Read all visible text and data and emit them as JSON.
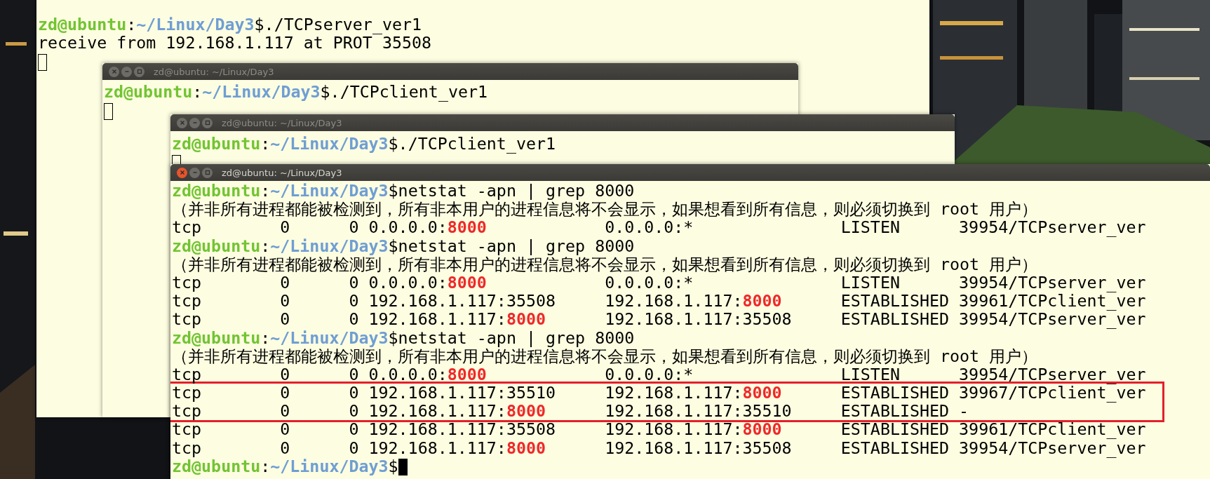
{
  "windows": [
    {
      "focused": false,
      "lines": [
        {
          "kind": "prompt",
          "user": "zd@ubuntu",
          "sep": ":",
          "path": "~/Linux/Day3",
          "sign": "$",
          "command": "./TCPserver_ver1"
        },
        {
          "kind": "output",
          "parts": [
            {
              "text": "receive from 192.168.1.117 at PROT 35508",
              "emphasis": false
            }
          ]
        },
        {
          "kind": "cursor"
        }
      ]
    },
    {
      "title": "zd@ubuntu: ~/Linux/Day3",
      "focused": false,
      "lines": [
        {
          "kind": "prompt",
          "user": "zd@ubuntu",
          "sep": ":",
          "path": "~/Linux/Day3",
          "sign": "$",
          "command": "./TCPclient_ver1"
        },
        {
          "kind": "cursor"
        }
      ]
    },
    {
      "title": "zd@ubuntu: ~/Linux/Day3",
      "focused": false,
      "lines": [
        {
          "kind": "prompt",
          "user": "zd@ubuntu",
          "sep": ":",
          "path": "~/Linux/Day3",
          "sign": "$",
          "command": "./TCPclient_ver1"
        },
        {
          "kind": "cursor"
        }
      ]
    },
    {
      "title": "zd@ubuntu: ~/Linux/Day3",
      "focused": true,
      "lines": [
        {
          "kind": "prompt",
          "user": "zd@ubuntu",
          "sep": ":",
          "path": "~/Linux/Day3",
          "sign": "$",
          "command": "netstat -apn | grep 8000"
        },
        {
          "kind": "output",
          "parts": [
            {
              "text": "（并非所有进程都能被检测到，所有非本用户的进程信息将不会显示，如果想看到所有信息，则必须切换到 root 用户）",
              "emphasis": false
            }
          ]
        },
        {
          "kind": "output",
          "parts": [
            {
              "text": "tcp        0      0 0.0.0.0:",
              "emphasis": false
            },
            {
              "text": "8000",
              "emphasis": true
            },
            {
              "text": "            0.0.0.0:*               LISTEN      39954/TCPserver_ver",
              "emphasis": false
            }
          ]
        },
        {
          "kind": "prompt",
          "user": "zd@ubuntu",
          "sep": ":",
          "path": "~/Linux/Day3",
          "sign": "$",
          "command": "netstat -apn | grep 8000"
        },
        {
          "kind": "output",
          "parts": [
            {
              "text": "（并非所有进程都能被检测到，所有非本用户的进程信息将不会显示，如果想看到所有信息，则必须切换到 root 用户）",
              "emphasis": false
            }
          ]
        },
        {
          "kind": "output",
          "parts": [
            {
              "text": "tcp        0      0 0.0.0.0:",
              "emphasis": false
            },
            {
              "text": "8000",
              "emphasis": true
            },
            {
              "text": "            0.0.0.0:*               LISTEN      39954/TCPserver_ver",
              "emphasis": false
            }
          ]
        },
        {
          "kind": "output",
          "parts": [
            {
              "text": "tcp        0      0 192.168.1.117:35508     192.168.1.117:",
              "emphasis": false
            },
            {
              "text": "8000",
              "emphasis": true
            },
            {
              "text": "      ESTABLISHED 39961/TCPclient_ver",
              "emphasis": false
            }
          ]
        },
        {
          "kind": "output",
          "parts": [
            {
              "text": "tcp        0      0 192.168.1.117:",
              "emphasis": false
            },
            {
              "text": "8000",
              "emphasis": true
            },
            {
              "text": "      192.168.1.117:35508     ESTABLISHED 39954/TCPserver_ver",
              "emphasis": false
            }
          ]
        },
        {
          "kind": "prompt",
          "user": "zd@ubuntu",
          "sep": ":",
          "path": "~/Linux/Day3",
          "sign": "$",
          "command": "netstat -apn | grep 8000"
        },
        {
          "kind": "output",
          "parts": [
            {
              "text": "（并非所有进程都能被检测到，所有非本用户的进程信息将不会显示，如果想看到所有信息，则必须切换到 root 用户）",
              "emphasis": false
            }
          ]
        },
        {
          "kind": "output",
          "parts": [
            {
              "text": "tcp        0      0 0.0.0.0:",
              "emphasis": false
            },
            {
              "text": "8000",
              "emphasis": true
            },
            {
              "text": "            0.0.0.0:*               LISTEN      39954/TCPserver_ver",
              "emphasis": false
            }
          ]
        },
        {
          "kind": "output",
          "boxed": true,
          "parts": [
            {
              "text": "tcp        0      0 192.168.1.117:35510     192.168.1.117:",
              "emphasis": false
            },
            {
              "text": "8000",
              "emphasis": true
            },
            {
              "text": "      ESTABLISHED 39967/TCPclient_ver",
              "emphasis": false
            }
          ]
        },
        {
          "kind": "output",
          "boxed": true,
          "parts": [
            {
              "text": "tcp        0      0 192.168.1.117:",
              "emphasis": false
            },
            {
              "text": "8000",
              "emphasis": true
            },
            {
              "text": "      192.168.1.117:35510     ESTABLISHED -",
              "emphasis": false
            }
          ]
        },
        {
          "kind": "output",
          "parts": [
            {
              "text": "tcp        0      0 192.168.1.117:35508     192.168.1.117:",
              "emphasis": false
            },
            {
              "text": "8000",
              "emphasis": true
            },
            {
              "text": "      ESTABLISHED 39961/TCPclient_ver",
              "emphasis": false
            }
          ]
        },
        {
          "kind": "output",
          "parts": [
            {
              "text": "tcp        0      0 192.168.1.117:",
              "emphasis": false
            },
            {
              "text": "8000",
              "emphasis": true
            },
            {
              "text": "      192.168.1.117:35508     ESTABLISHED 39954/TCPserver_ver",
              "emphasis": false
            }
          ]
        },
        {
          "kind": "prompt",
          "user": "zd@ubuntu",
          "sep": ":",
          "path": "~/Linux/Day3",
          "sign": "$",
          "cursor": true
        }
      ]
    }
  ]
}
